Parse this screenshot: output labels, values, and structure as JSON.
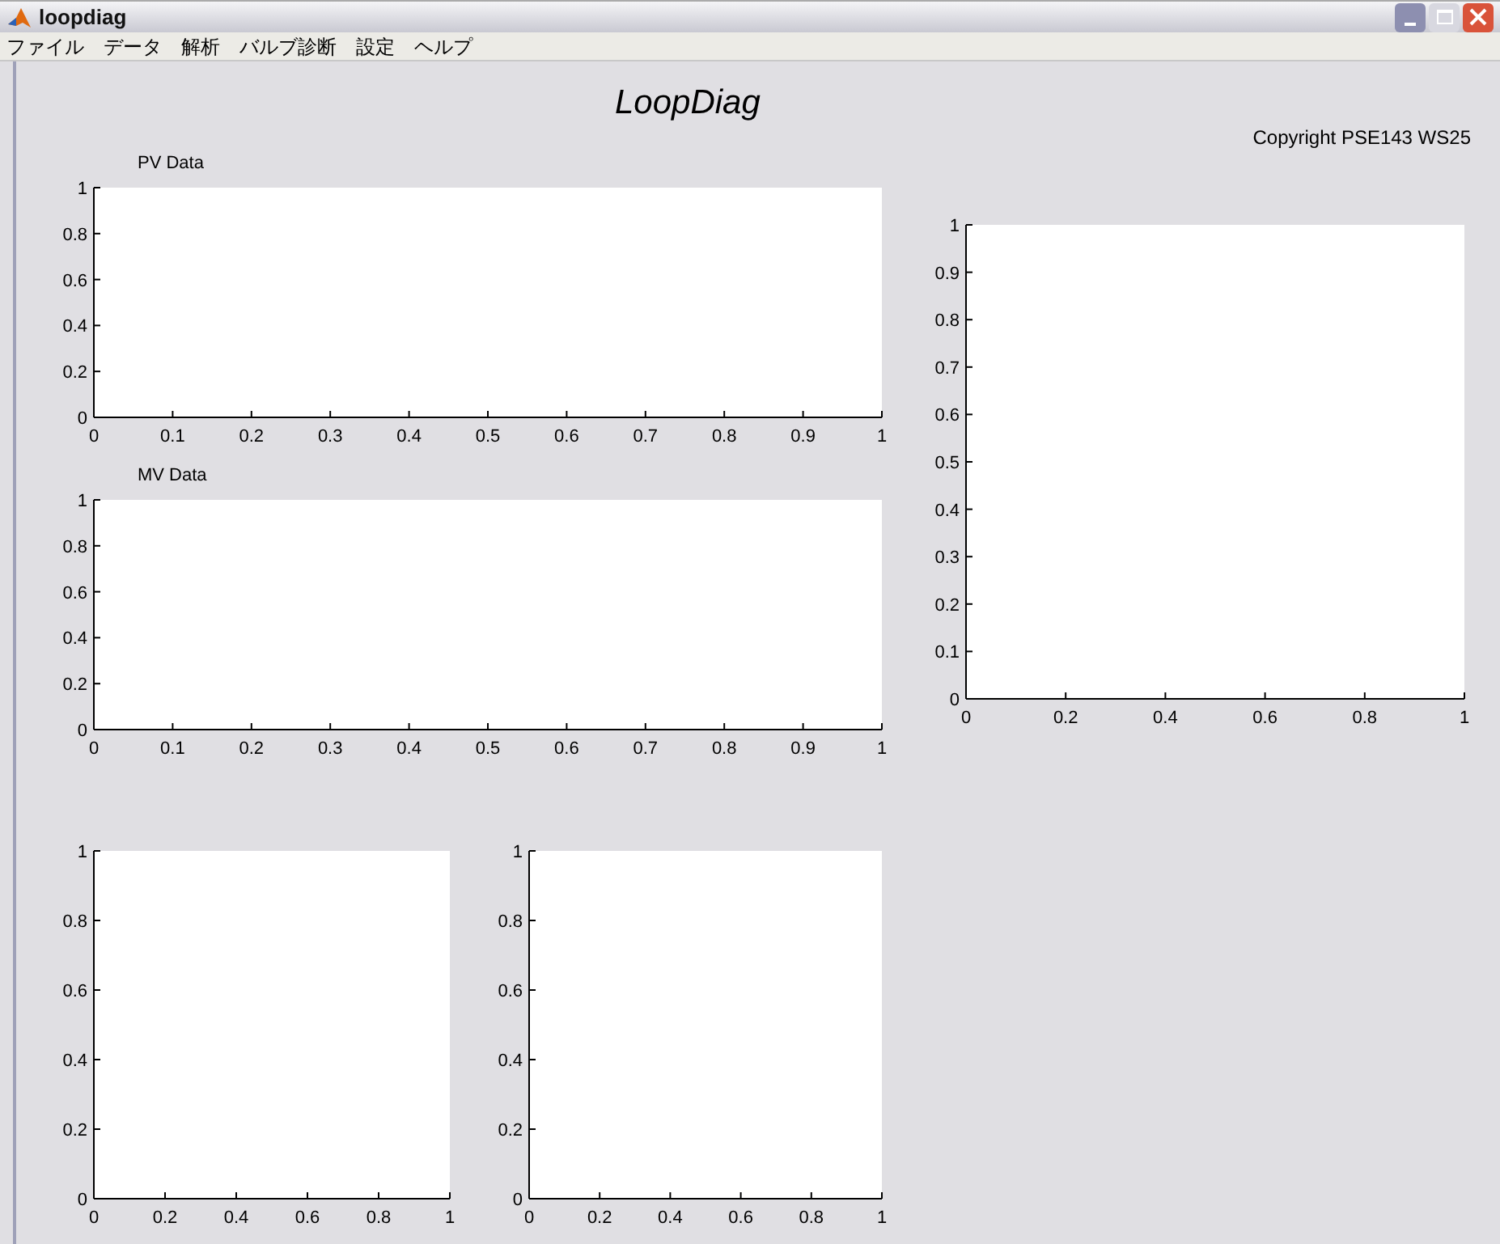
{
  "window": {
    "title": "loopdiag"
  },
  "menu": [
    "ファイル",
    "データ",
    "解析",
    "バルブ診断",
    "設定",
    "ヘルプ"
  ],
  "header": {
    "title": "LoopDiag",
    "copyright": "Copyright PSE143 WS25"
  },
  "axes": [
    {
      "chart_data": {
        "type": "line",
        "title": "PV Data",
        "xlim": [
          0,
          1
        ],
        "ylim": [
          0,
          1
        ],
        "xticks": [
          0,
          0.1,
          0.2,
          0.3,
          0.4,
          0.5,
          0.6,
          0.7,
          0.8,
          0.9,
          1
        ],
        "yticks": [
          0,
          0.2,
          0.4,
          0.6,
          0.8,
          1
        ]
      }
    },
    {
      "chart_data": {
        "type": "line",
        "title": "MV Data",
        "xlim": [
          0,
          1
        ],
        "ylim": [
          0,
          1
        ],
        "xticks": [
          0,
          0.1,
          0.2,
          0.3,
          0.4,
          0.5,
          0.6,
          0.7,
          0.8,
          0.9,
          1
        ],
        "yticks": [
          0,
          0.2,
          0.4,
          0.6,
          0.8,
          1
        ]
      }
    },
    {
      "chart_data": {
        "type": "line",
        "xlim": [
          0,
          1
        ],
        "ylim": [
          0,
          1
        ],
        "xticks": [
          0,
          0.2,
          0.4,
          0.6,
          0.8,
          1
        ],
        "yticks": [
          0,
          0.2,
          0.4,
          0.6,
          0.8,
          1
        ]
      }
    },
    {
      "chart_data": {
        "type": "line",
        "xlim": [
          0,
          1
        ],
        "ylim": [
          0,
          1
        ],
        "xticks": [
          0,
          0.2,
          0.4,
          0.6,
          0.8,
          1
        ],
        "yticks": [
          0,
          0.2,
          0.4,
          0.6,
          0.8,
          1
        ]
      }
    },
    {
      "chart_data": {
        "type": "line",
        "xlim": [
          0,
          1
        ],
        "ylim": [
          0,
          1
        ],
        "xticks": [
          0,
          0.2,
          0.4,
          0.6,
          0.8,
          1
        ],
        "yticks": [
          0,
          0.1,
          0.2,
          0.3,
          0.4,
          0.5,
          0.6,
          0.7,
          0.8,
          0.9,
          1
        ]
      }
    }
  ]
}
